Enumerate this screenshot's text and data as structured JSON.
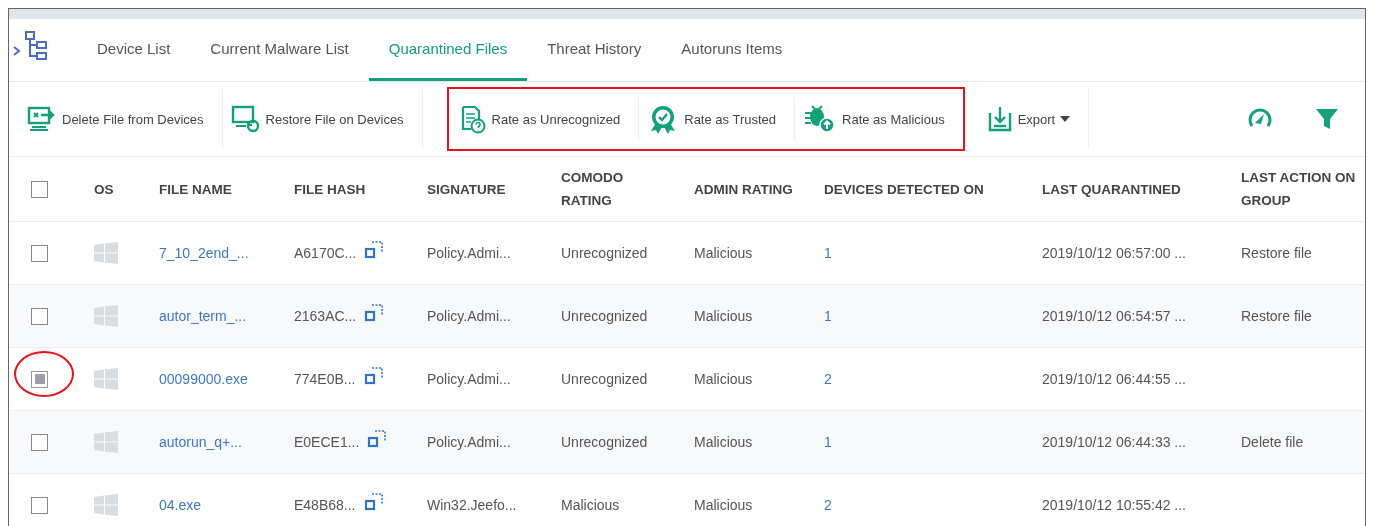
{
  "tabs": [
    {
      "label": "Device List",
      "selected": false
    },
    {
      "label": "Current Malware List",
      "selected": false
    },
    {
      "label": "Quarantined Files",
      "selected": true
    },
    {
      "label": "Threat History",
      "selected": false
    },
    {
      "label": "Autoruns Items",
      "selected": false
    }
  ],
  "toolbar": {
    "groups": [
      {
        "highlighted": false,
        "buttons": [
          {
            "label": "Delete File from Devices",
            "kind": "button"
          }
        ]
      },
      {
        "highlighted": false,
        "buttons": [
          {
            "label": "Restore File on Devices",
            "kind": "button"
          }
        ]
      },
      {
        "highlighted": true,
        "buttons": [
          {
            "label": "Rate as Unrecognized",
            "kind": "button"
          },
          {
            "label": "Rate as Trusted",
            "kind": "button"
          },
          {
            "label": "Rate as Malicious",
            "kind": "button"
          }
        ]
      },
      {
        "highlighted": false,
        "buttons": [
          {
            "label": "Export",
            "kind": "dropdown"
          }
        ]
      }
    ]
  },
  "table": {
    "all_checked": false,
    "columns": [
      "OS",
      "FILE NAME",
      "FILE HASH",
      "SIGNATURE",
      "COMODO RATING",
      "ADMIN RATING",
      "DEVICES DETECTED ON",
      "LAST QUARANTINED",
      "LAST ACTION ON GROUP"
    ],
    "rows": [
      {
        "checked": false,
        "circled": false,
        "file_name": "7_10_2end_...",
        "file_hash": "A6170C...",
        "signature": "Policy.Admi...",
        "comodo_rating": "Unrecognized",
        "admin_rating": "Malicious",
        "devices": "1",
        "last_quarantined": "2019/10/12 06:57:00 ...",
        "last_action": "Restore file"
      },
      {
        "checked": false,
        "circled": false,
        "file_name": "autor_term_...",
        "file_hash": "2163AC...",
        "signature": "Policy.Admi...",
        "comodo_rating": "Unrecognized",
        "admin_rating": "Malicious",
        "devices": "1",
        "last_quarantined": "2019/10/12 06:54:57 ...",
        "last_action": "Restore file"
      },
      {
        "checked": true,
        "circled": true,
        "file_name": "00099000.exe",
        "file_hash": "774E0B...",
        "signature": "Policy.Admi...",
        "comodo_rating": "Unrecognized",
        "admin_rating": "Malicious",
        "devices": "2",
        "last_quarantined": "2019/10/12 06:44:55 ..."
      },
      {
        "checked": false,
        "circled": false,
        "file_name": "autorun_q+...",
        "file_hash": "E0ECE1...",
        "signature": "Policy.Admi...",
        "comodo_rating": "Unrecognized",
        "admin_rating": "Malicious",
        "devices": "1",
        "last_quarantined": "2019/10/12 06:44:33 ...",
        "last_action": "Delete file"
      },
      {
        "checked": false,
        "circled": false,
        "file_name": "04.exe",
        "file_hash": "E48B68...",
        "signature": "Win32.Jeefo...",
        "comodo_rating": "Malicious",
        "admin_rating": "Malicious",
        "devices": "2",
        "last_quarantined": "2019/10/12 10:55:42 ..."
      }
    ]
  }
}
